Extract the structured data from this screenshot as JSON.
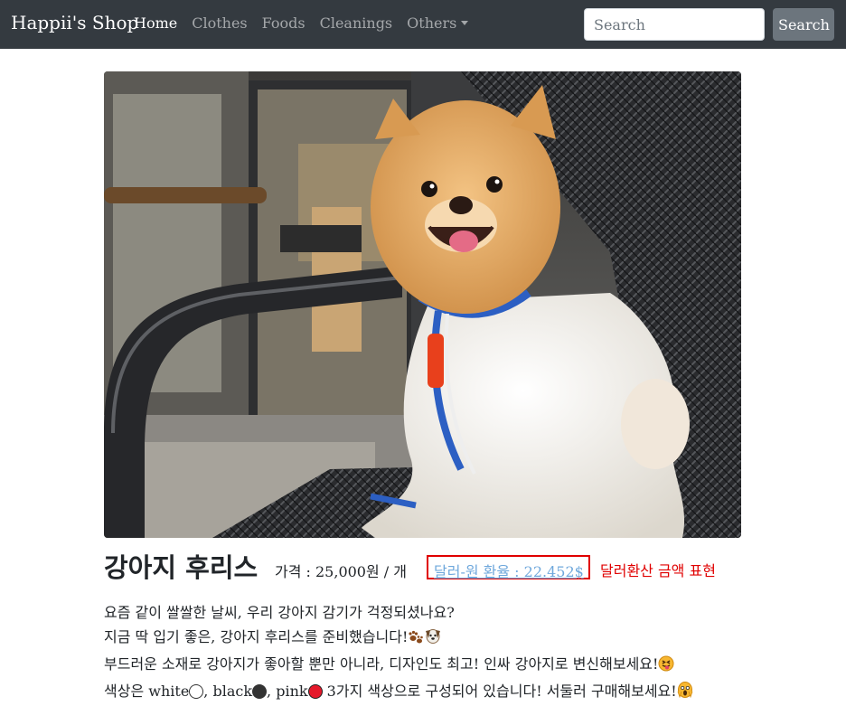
{
  "navbar": {
    "brand": "Happii's Shop",
    "links": [
      {
        "label": "Home",
        "active": true
      },
      {
        "label": "Clothes",
        "active": false
      },
      {
        "label": "Foods",
        "active": false
      },
      {
        "label": "Cleanings",
        "active": false
      },
      {
        "label": "Others",
        "active": false,
        "dropdown": true
      }
    ],
    "search_placeholder": "Search",
    "search_button": "Search"
  },
  "product": {
    "image_icon": "pomeranian-photo",
    "title": "강아지 후리스",
    "price": "가격 : 25,000원 / 개",
    "exchange_link": "달러-원 환율 : 22.452$",
    "exchange_note": "달러환산 금액 표현",
    "description": {
      "line1": "요즘 같이 쌀쌀한 날씨, 우리 강아지 감기가 걱정되셨나요?",
      "line2": "지금 딱 입기 좋은, 강아지 후리스를 준비했습니다!",
      "line3": "부드러운 소재로 강아지가 좋아할 뿐만 아니라, 디자인도 최고! 인싸 강아지로 변신해보세요!",
      "line4_prefix": "색상은",
      "colors": [
        {
          "name": "white",
          "separator": ",",
          "hex": "#ffffff"
        },
        {
          "name": "black",
          "separator": ",",
          "hex": "#333333"
        },
        {
          "name": "pink",
          "separator": "",
          "hex": "#e5192b"
        }
      ],
      "line4_suffix": "3가지 색상으로 구성되어 있습니다! 서둘러 구매해보세요!"
    }
  },
  "colors": {
    "navbar_bg": "#343a40",
    "highlight_border": "#e00000",
    "link": "#6fa8dc"
  }
}
